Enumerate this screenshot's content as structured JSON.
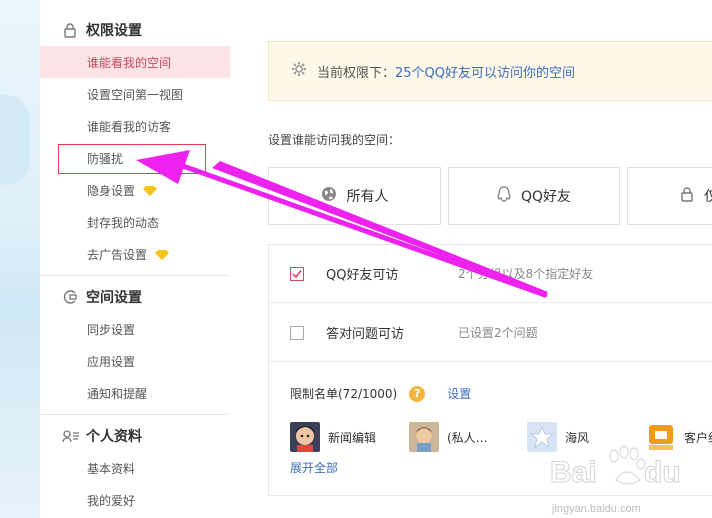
{
  "sidebar": {
    "sections": [
      {
        "title": "权限设置",
        "icon": "lock-icon"
      },
      {
        "title": "空间设置",
        "icon": "settings-icon"
      },
      {
        "title": "个人资料",
        "icon": "profile-card-icon"
      }
    ],
    "items": [
      {
        "label": "谁能看我的空间"
      },
      {
        "label": "设置空间第一视图"
      },
      {
        "label": "谁能看我的访客"
      },
      {
        "label": "防骚扰"
      },
      {
        "label": "隐身设置"
      },
      {
        "label": "封存我的动态"
      },
      {
        "label": "去广告设置"
      },
      {
        "label": "同步设置"
      },
      {
        "label": "应用设置"
      },
      {
        "label": "通知和提醒"
      },
      {
        "label": "基本资料"
      },
      {
        "label": "我的爱好"
      }
    ]
  },
  "notice": {
    "prefix": "当前权限下：",
    "text": "25个QQ好友可以访问你的空间",
    "icon": "gear-icon"
  },
  "question": "设置谁能访问我的空间：",
  "options": [
    {
      "label": "所有人",
      "icon": "globe-icon"
    },
    {
      "label": "QQ好友",
      "icon": "qq-penguin-icon"
    },
    {
      "label": "仅",
      "icon": "lock-icon"
    }
  ],
  "rows": [
    {
      "label": "QQ好友可访",
      "sub": "2个分组以及8个指定好友",
      "checked": true
    },
    {
      "label": "答对问题可访",
      "sub": "已设置2个问题",
      "checked": false
    }
  ],
  "limit": {
    "title": "限制名单(72/1000)",
    "help": "?",
    "settings": "设置",
    "friends": [
      "新闻编辑",
      "(私人…",
      "海风",
      "客户约"
    ],
    "expand": "展开全部"
  },
  "colors": {
    "accent_pink": "#c94a5d",
    "highlight_red": "#e53950",
    "link_blue": "#3b6dba",
    "arrow_magenta": "#ee22ee",
    "gem_yellow": "#f5c518"
  },
  "watermark": {
    "logo": "Bai du 经验",
    "url": "jingyan.baidu.com"
  }
}
